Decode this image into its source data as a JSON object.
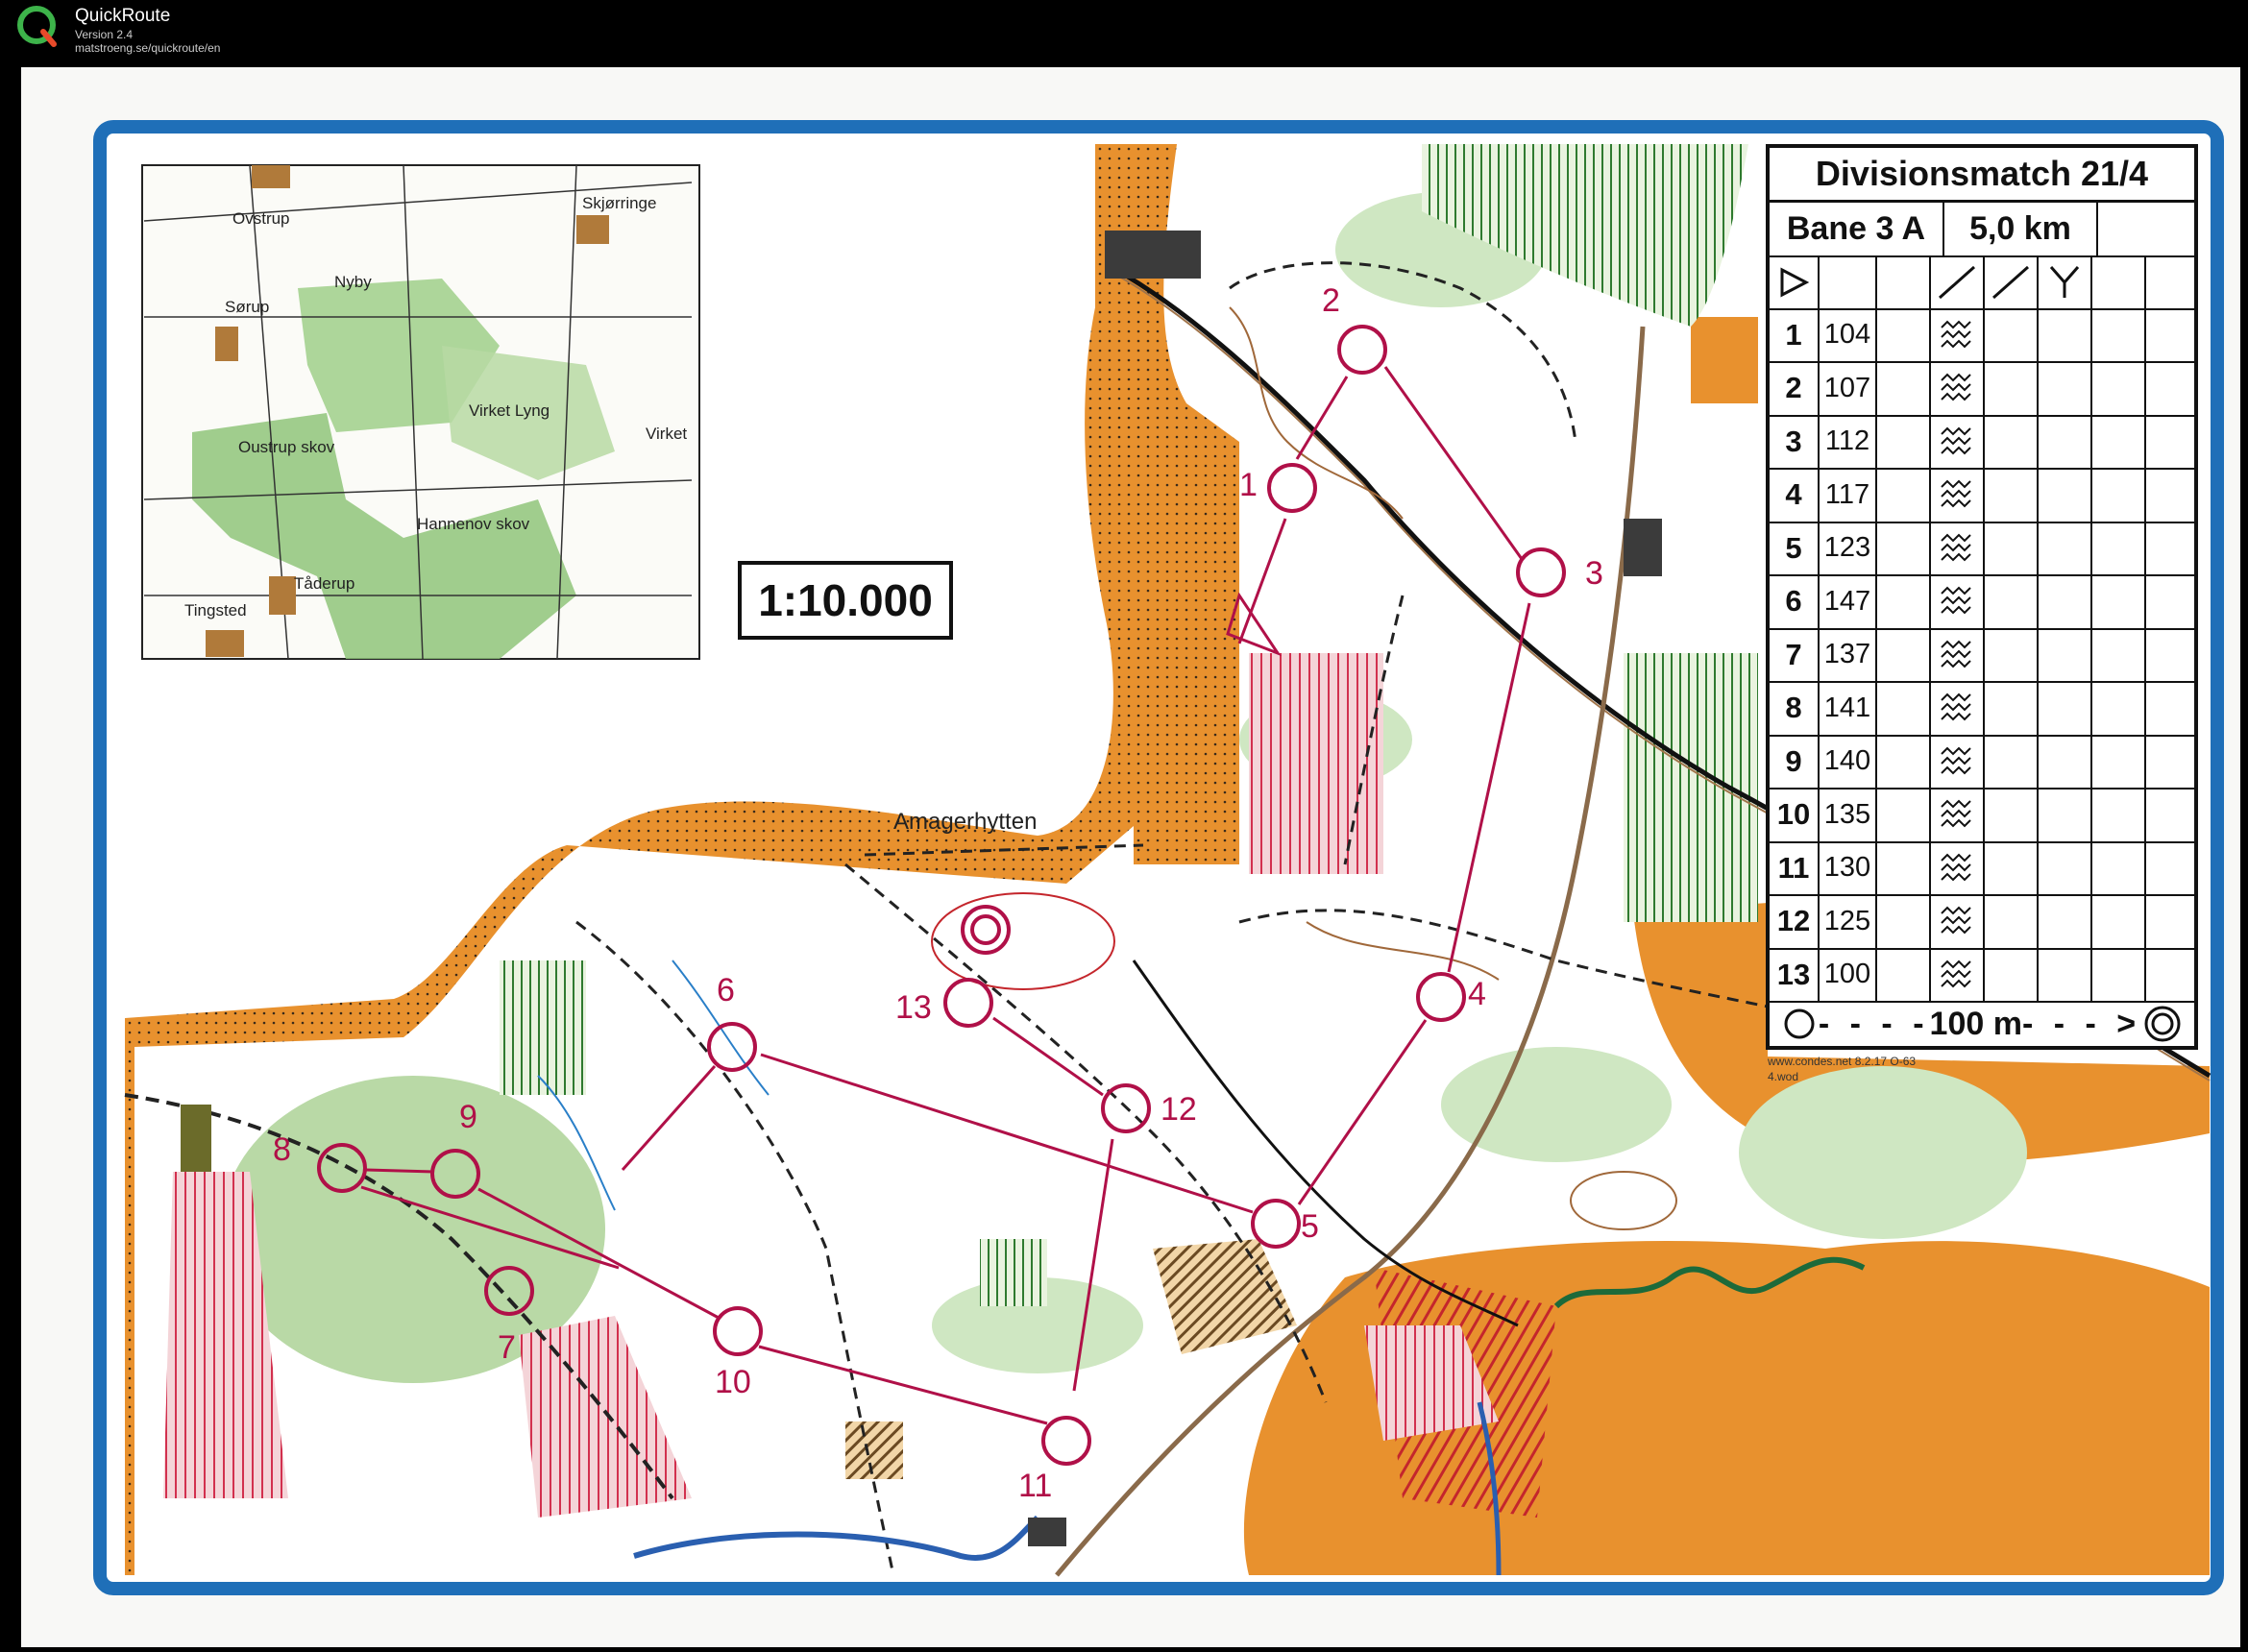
{
  "app": {
    "name": "QuickRoute",
    "version": "Version 2.4",
    "url": "matstroeng.se/quickroute/en"
  },
  "map": {
    "scale": "1:10.000",
    "place_label": "Amagerhytten",
    "print_info_line1": "www.condes.net 8.2.17 O-63",
    "print_info_line2": "4.wod",
    "colors": {
      "frame": "#1f6fb8",
      "course": "#b01048",
      "open_land": "#e8912e",
      "forest_green": "#8fc47a",
      "paper": "#f8f8f6"
    }
  },
  "inset": {
    "labels": [
      "Ovstrup",
      "Skjørringe",
      "Nyby",
      "Sørup",
      "Virket Lyng",
      "Virket",
      "Oustrup skov",
      "Hannenov skov",
      "Tåderup",
      "Tingsted"
    ]
  },
  "course": {
    "event": "Divisionsmatch 21/4",
    "class": "Bane 3 A",
    "length": "5,0 km",
    "footer": "100 m",
    "controls": [
      {
        "num": "1",
        "code": "104"
      },
      {
        "num": "2",
        "code": "107"
      },
      {
        "num": "3",
        "code": "112"
      },
      {
        "num": "4",
        "code": "117"
      },
      {
        "num": "5",
        "code": "123"
      },
      {
        "num": "6",
        "code": "147"
      },
      {
        "num": "7",
        "code": "137"
      },
      {
        "num": "8",
        "code": "141"
      },
      {
        "num": "9",
        "code": "140"
      },
      {
        "num": "10",
        "code": "135"
      },
      {
        "num": "11",
        "code": "130"
      },
      {
        "num": "12",
        "code": "125"
      },
      {
        "num": "13",
        "code": "100"
      }
    ],
    "map_control_labels": [
      "1",
      "2",
      "3",
      "4",
      "5",
      "6",
      "7",
      "8",
      "9",
      "10",
      "11",
      "12",
      "13"
    ]
  }
}
